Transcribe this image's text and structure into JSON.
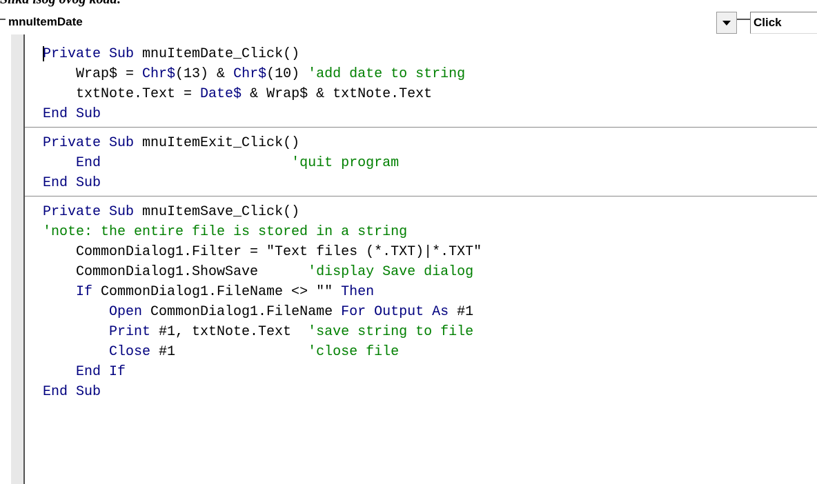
{
  "caption": "Slika isog ovog koda:",
  "toolbar": {
    "object": "mnuItemDate",
    "procedure": "Click"
  },
  "code": {
    "blocks": [
      [
        [
          [
            "kw",
            "Private Sub "
          ],
          [
            "tx",
            "mnuItemDate_Click()"
          ]
        ],
        [
          [
            "tx",
            "    Wrap$ = "
          ],
          [
            "kw",
            "Chr$"
          ],
          [
            "tx",
            "(13) & "
          ],
          [
            "kw",
            "Chr$"
          ],
          [
            "tx",
            "(10) "
          ],
          [
            "cm",
            "'add date to string"
          ]
        ],
        [
          [
            "tx",
            "    txtNote.Text = "
          ],
          [
            "kw",
            "Date$"
          ],
          [
            "tx",
            " & Wrap$ & txtNote.Text"
          ]
        ],
        [
          [
            "kw",
            "End Sub"
          ]
        ]
      ],
      [
        [
          [
            "kw",
            "Private Sub "
          ],
          [
            "tx",
            "mnuItemExit_Click()"
          ]
        ],
        [
          [
            "kw",
            "    End"
          ],
          [
            "tx",
            "                       "
          ],
          [
            "cm",
            "'quit program"
          ]
        ],
        [
          [
            "kw",
            "End Sub"
          ]
        ]
      ],
      [
        [
          [
            "kw",
            "Private Sub "
          ],
          [
            "tx",
            "mnuItemSave_Click()"
          ]
        ],
        [
          [
            "cm",
            "'note: the entire file is stored in a string"
          ]
        ],
        [
          [
            "tx",
            "    CommonDialog1.Filter = \"Text files (*.TXT)|*.TXT\""
          ]
        ],
        [
          [
            "tx",
            "    CommonDialog1.ShowSave      "
          ],
          [
            "cm",
            "'display Save dialog"
          ]
        ],
        [
          [
            "kw",
            "    If "
          ],
          [
            "tx",
            "CommonDialog1.FileName <> \"\" "
          ],
          [
            "kw",
            "Then"
          ]
        ],
        [
          [
            "kw",
            "        Open "
          ],
          [
            "tx",
            "CommonDialog1.FileName "
          ],
          [
            "kw",
            "For Output As "
          ],
          [
            "tx",
            "#1"
          ]
        ],
        [
          [
            "kw",
            "        Print "
          ],
          [
            "tx",
            "#1, txtNote.Text  "
          ],
          [
            "cm",
            "'save string to file"
          ]
        ],
        [
          [
            "kw",
            "        Close "
          ],
          [
            "tx",
            "#1                "
          ],
          [
            "cm",
            "'close file"
          ]
        ],
        [
          [
            "kw",
            "    End If"
          ]
        ],
        [
          [
            "kw",
            "End Sub"
          ]
        ]
      ]
    ]
  }
}
